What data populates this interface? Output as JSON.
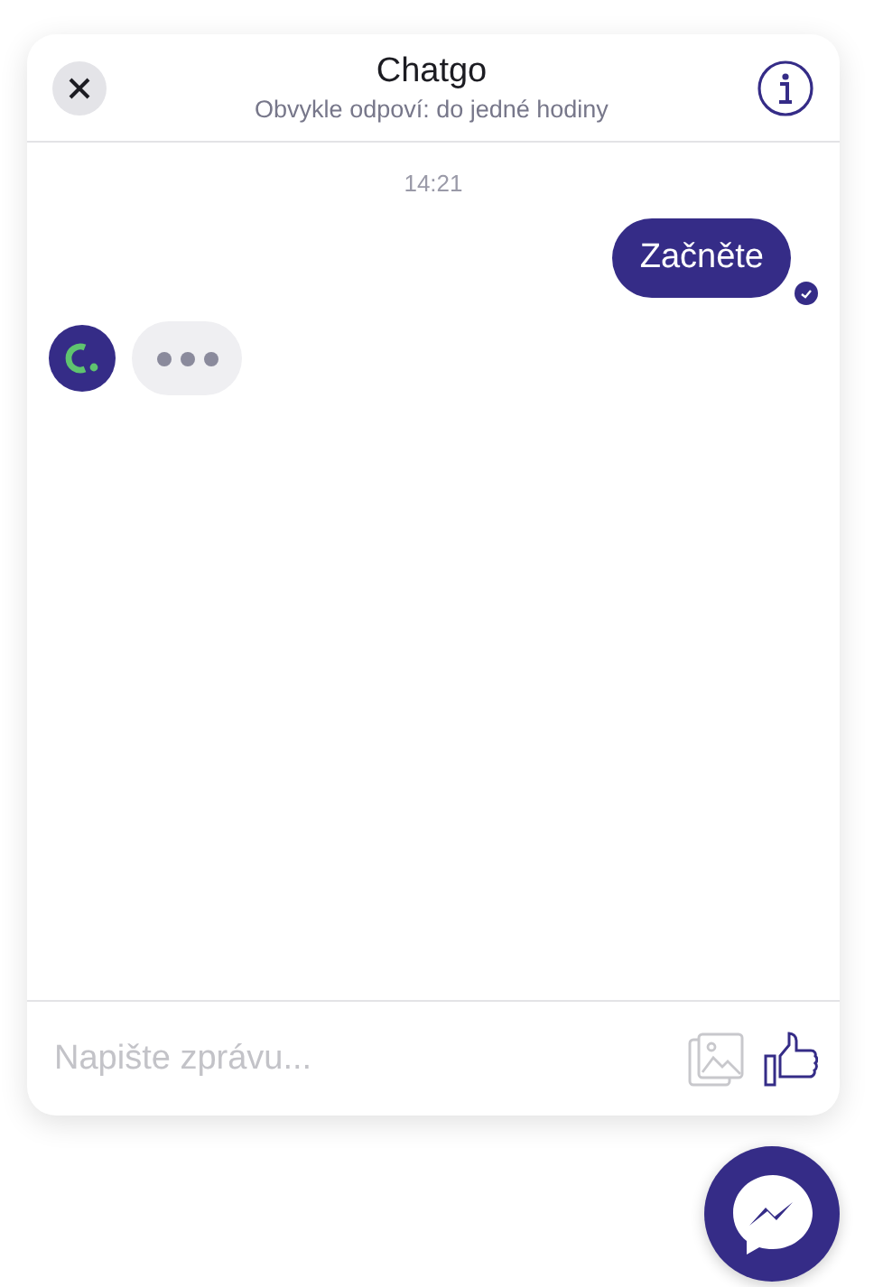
{
  "header": {
    "title": "Chatgo",
    "subtitle": "Obvykle odpoví: do jedné hodiny"
  },
  "timestamp": "14:21",
  "messages": [
    {
      "kind": "sent",
      "text": "Začněte",
      "delivered": true
    },
    {
      "kind": "typing"
    }
  ],
  "composer": {
    "placeholder": "Napište zprávu..."
  }
}
